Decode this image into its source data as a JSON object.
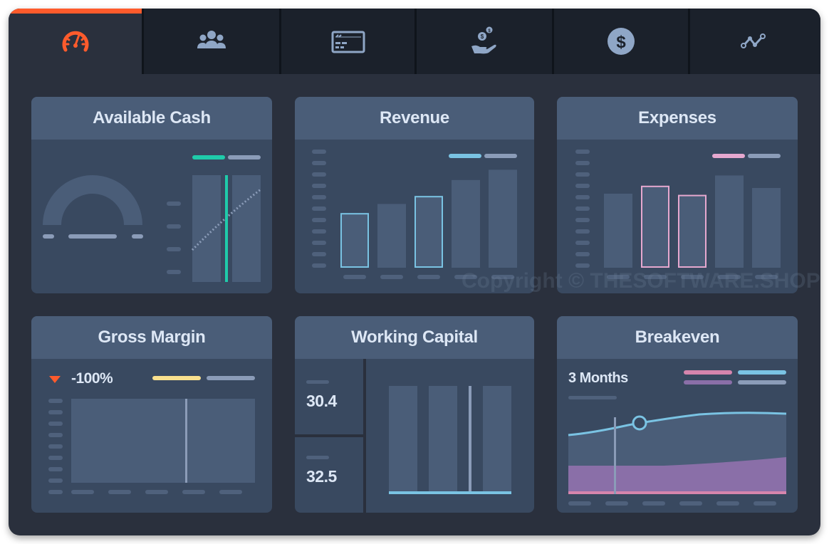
{
  "tabs": [
    {
      "name": "dashboard",
      "icon": "speedometer-icon",
      "active": true
    },
    {
      "name": "people",
      "icon": "users-icon",
      "active": false
    },
    {
      "name": "payments",
      "icon": "credit-card-icon",
      "active": false
    },
    {
      "name": "receivables",
      "icon": "hand-coins-icon",
      "active": false
    },
    {
      "name": "cash",
      "icon": "dollar-circle-icon",
      "active": false
    },
    {
      "name": "trends",
      "icon": "line-chart-icon",
      "active": false
    }
  ],
  "colors": {
    "accent": "#fe5b2c",
    "teal": "#1fcbaa",
    "blue": "#7ac3e3",
    "pink": "#e6a8cf",
    "yellow": "#f9e08e",
    "purple": "#8a6fa8",
    "rose": "#d685ad",
    "muted": "#8b9cb8"
  },
  "cards": {
    "available_cash": {
      "title": "Available Cash",
      "gauge_fraction": 0,
      "bars_count": 2,
      "marker_position": 0.5
    },
    "revenue": {
      "title": "Revenue",
      "bars": [
        0.48,
        0.56,
        0.63,
        0.77,
        0.86
      ],
      "highlighted": [
        true,
        false,
        true,
        false,
        false
      ]
    },
    "expenses": {
      "title": "Expenses",
      "bars": [
        0.65,
        0.72,
        0.64,
        0.81,
        0.7
      ],
      "highlighted": [
        false,
        true,
        true,
        false,
        false
      ]
    },
    "gross_margin": {
      "title": "Gross Margin",
      "change_value": "-100%",
      "trend": "down",
      "marker_position": 0.63
    },
    "working_capital": {
      "title": "Working Capital",
      "value_1": "30.4",
      "value_2": "32.5",
      "bars_count": 3
    },
    "breakeven": {
      "title": "Breakeven",
      "value": "3 Months",
      "marker_position": 0.33
    }
  },
  "watermark": "Copyright © THESOFTWARE.SHOP"
}
